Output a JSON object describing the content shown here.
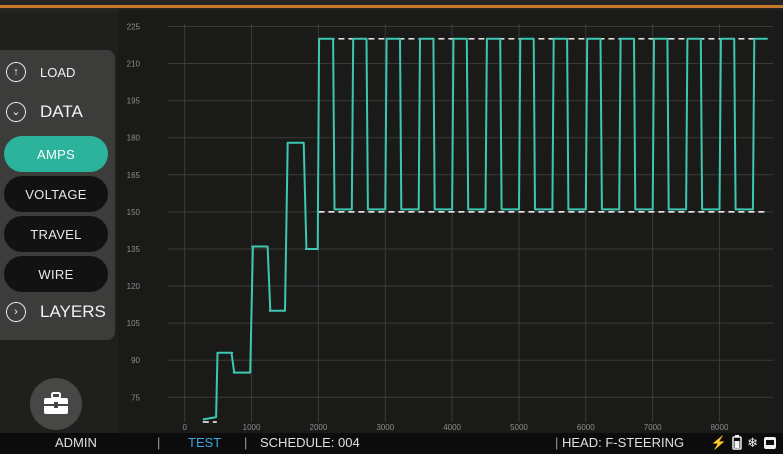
{
  "side_menu": {
    "load": "LOAD",
    "data": "DATA",
    "layers": "LAYERS",
    "items": [
      {
        "label": "AMPS",
        "active": true
      },
      {
        "label": "VOLTAGE",
        "active": false
      },
      {
        "label": "TRAVEL",
        "active": false
      },
      {
        "label": "WIRE",
        "active": false
      }
    ]
  },
  "status": {
    "user": "ADMIN",
    "mode": "TEST",
    "schedule": "SCHEDULE: 004",
    "head": "HEAD: F-STEERING",
    "sep1": "|",
    "sep2": "|",
    "sep3": "|"
  },
  "icons": [
    "arrow-up-icon",
    "chevron-down-icon",
    "chevron-right-icon",
    "toolbox-icon",
    "lightning-icon",
    "battery-icon",
    "snowflake-icon",
    "display-icon"
  ],
  "colors": {
    "accent": "#2bb39b",
    "trace": "#3cc7b0",
    "background": "#1a1b19",
    "top_accent": "#c8782a"
  },
  "chart_data": {
    "type": "line",
    "title": "",
    "xlabel": "",
    "ylabel": "",
    "xlim": [
      -250,
      8800
    ],
    "ylim": [
      65,
      226
    ],
    "x_ticks": [
      0,
      1000,
      2000,
      3000,
      4000,
      5000,
      6000,
      7000,
      8000
    ],
    "y_ticks": [
      75,
      90,
      105,
      120,
      135,
      150,
      165,
      180,
      195,
      210,
      225
    ],
    "grid": true,
    "reference_lines": [
      150,
      220
    ],
    "setpoints": [
      {
        "x": [
          270,
          480
        ],
        "y": 65
      },
      {
        "x": [
          480,
          720
        ],
        "y": 93
      },
      {
        "x": [
          720,
          1000
        ],
        "y": 85
      },
      {
        "x": [
          1000,
          1260
        ],
        "y": 136
      },
      {
        "x": [
          1260,
          1530
        ],
        "y": 110
      },
      {
        "x": [
          1530,
          1800
        ],
        "y": 178
      },
      {
        "x": [
          1800,
          2000
        ],
        "y": 135
      },
      {
        "x": [
          2000,
          8700
        ],
        "y_high": 220,
        "y_low": 150,
        "period": 500
      }
    ],
    "series": [
      {
        "x": [
          270,
          470,
          490,
          700,
          740,
          980,
          1020,
          1240,
          1280,
          1500,
          1540,
          1780,
          1820,
          1990,
          2010,
          2220,
          2240,
          2500,
          2520,
          2720,
          2740,
          3000,
          3020,
          3220,
          3240,
          3500,
          3520,
          3720,
          3740,
          4000,
          4020,
          4220,
          4240,
          4500,
          4520,
          4720,
          4740,
          5000,
          5020,
          5220,
          5240,
          5500,
          5520,
          5720,
          5740,
          6000,
          6020,
          6220,
          6240,
          6500,
          6520,
          6720,
          6740,
          7000,
          7020,
          7220,
          7240,
          7500,
          7520,
          7720,
          7740,
          8000,
          8020,
          8220,
          8240,
          8500,
          8520,
          8720
        ],
        "y": [
          66,
          67,
          93,
          93,
          85,
          85,
          136,
          136,
          110,
          110,
          178,
          178,
          135,
          135,
          220,
          220,
          151,
          151,
          220,
          220,
          151,
          151,
          220,
          220,
          151,
          151,
          220,
          220,
          151,
          151,
          220,
          220,
          151,
          151,
          220,
          220,
          151,
          151,
          220,
          220,
          151,
          151,
          220,
          220,
          151,
          151,
          220,
          220,
          151,
          151,
          220,
          220,
          151,
          151,
          220,
          220,
          151,
          151,
          220,
          220,
          151,
          151,
          220,
          220,
          151,
          151,
          220,
          220
        ]
      }
    ]
  }
}
